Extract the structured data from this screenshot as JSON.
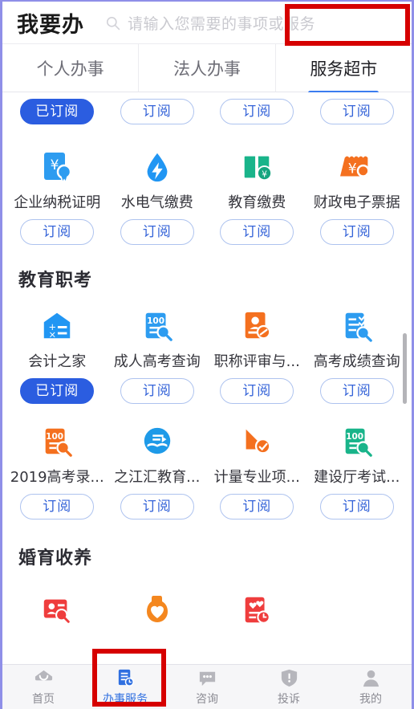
{
  "header": {
    "app_title": "我要办",
    "search": {
      "placeholder": "请输入您需要的事项或服务",
      "icon": "search-icon"
    }
  },
  "tabs": [
    {
      "label": "个人办事",
      "active": false
    },
    {
      "label": "法人办事",
      "active": false
    },
    {
      "label": "服务超市",
      "active": true
    }
  ],
  "annotations": {
    "tab_highlight_color": "#d60000",
    "nav_highlight_color": "#d60000"
  },
  "buttons": {
    "subscribe": "订阅",
    "subscribed": "已订阅"
  },
  "colors": {
    "accent_blue": "#2b5de0",
    "tab_indicator": "#3b7cf0",
    "orange": "#f4701f",
    "green": "#19b48a",
    "red": "#ef3d3d",
    "outline_border": "#aec3ef"
  },
  "partial_row": {
    "buttons": [
      {
        "label": "已订阅",
        "subscribed": true
      },
      {
        "label": "订阅",
        "subscribed": false
      },
      {
        "label": "订阅",
        "subscribed": false
      },
      {
        "label": "订阅",
        "subscribed": false
      }
    ]
  },
  "rows": [
    {
      "items": [
        {
          "label": "企业纳税证明",
          "icon": "tax-certificate-icon",
          "button": "订阅",
          "subscribed": false
        },
        {
          "label": "水电气缴费",
          "icon": "utility-payment-icon",
          "button": "订阅",
          "subscribed": false
        },
        {
          "label": "教育缴费",
          "icon": "education-payment-icon",
          "button": "订阅",
          "subscribed": false
        },
        {
          "label": "财政电子票据",
          "icon": "e-invoice-icon",
          "button": "订阅",
          "subscribed": false
        }
      ]
    }
  ],
  "sections": [
    {
      "title": "教育职考",
      "rows": [
        {
          "items": [
            {
              "label": "会计之家",
              "icon": "accounting-home-icon",
              "button": "已订阅",
              "subscribed": true
            },
            {
              "label": "成人高考查询",
              "icon": "adult-exam-query-icon",
              "button": "订阅",
              "subscribed": false
            },
            {
              "label": "职称评审与...",
              "icon": "title-review-icon",
              "button": "订阅",
              "subscribed": false
            },
            {
              "label": "高考成绩查询",
              "icon": "gaokao-score-icon",
              "button": "订阅",
              "subscribed": false
            }
          ]
        },
        {
          "items": [
            {
              "label": "2019高考录...",
              "icon": "gaokao-admission-icon",
              "button": "订阅",
              "subscribed": false
            },
            {
              "label": "之江汇教育...",
              "icon": "zhijianghui-edu-icon",
              "button": "订阅",
              "subscribed": false
            },
            {
              "label": "计量专业项...",
              "icon": "metrology-project-icon",
              "button": "订阅",
              "subscribed": false
            },
            {
              "label": "建设厅考试...",
              "icon": "construction-exam-icon",
              "button": "订阅",
              "subscribed": false
            }
          ]
        }
      ]
    },
    {
      "title": "婚育收养",
      "rows": [
        {
          "items": [
            {
              "label": "",
              "icon": "marriage-record-query-icon",
              "button": "",
              "subscribed": false
            },
            {
              "label": "",
              "icon": "heart-care-icon",
              "button": "",
              "subscribed": false
            },
            {
              "label": "",
              "icon": "birth-record-icon",
              "button": "",
              "subscribed": false
            },
            {
              "label": "",
              "icon": "",
              "button": "",
              "subscribed": false
            }
          ]
        }
      ]
    }
  ],
  "bottom_nav": [
    {
      "label": "首页",
      "icon": "home-icon",
      "active": false
    },
    {
      "label": "办事服务",
      "icon": "service-doc-icon",
      "active": true
    },
    {
      "label": "咨询",
      "icon": "chat-icon",
      "active": false
    },
    {
      "label": "投诉",
      "icon": "complaint-shield-icon",
      "active": false
    },
    {
      "label": "我的",
      "icon": "user-profile-icon",
      "active": false
    }
  ]
}
